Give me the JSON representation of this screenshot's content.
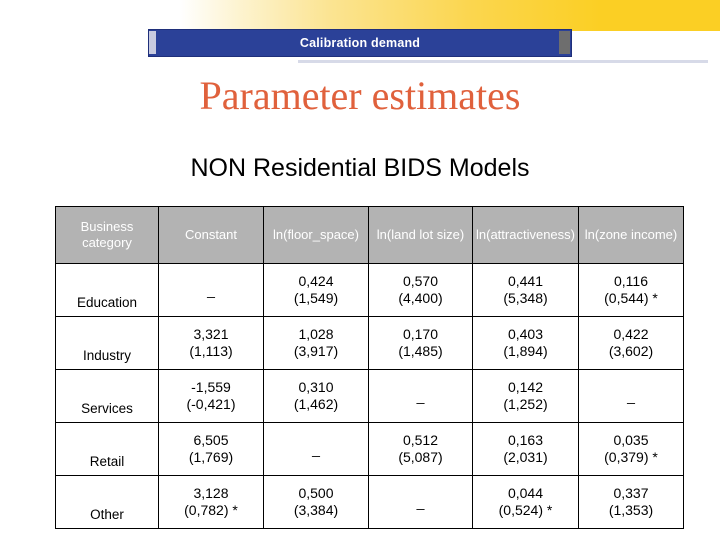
{
  "banner": {
    "label": "Calibration demand"
  },
  "titles": {
    "main": "Parameter estimates",
    "sub": "NON Residential BIDS Models"
  },
  "colors": {
    "title_orange": "#e0613c",
    "banner_blue": "#2b4198",
    "band_yellow": "#fbcf24",
    "header_gray": "#b3b3b3"
  },
  "table": {
    "headers": [
      "Business category",
      "Constant",
      "ln(floor_space)",
      "ln(land lot size)",
      "ln(attractiveness)",
      "ln(zone income)"
    ],
    "rows": [
      {
        "category": "Education",
        "cells": [
          {
            "estimate": "_",
            "tstat": ""
          },
          {
            "estimate": "0,424",
            "tstat": "(1,549)"
          },
          {
            "estimate": "0,570",
            "tstat": "(4,400)"
          },
          {
            "estimate": "0,441",
            "tstat": "(5,348)"
          },
          {
            "estimate": "0,116",
            "tstat": "(0,544) *"
          }
        ]
      },
      {
        "category": "Industry",
        "cells": [
          {
            "estimate": "3,321",
            "tstat": "(1,113)"
          },
          {
            "estimate": "1,028",
            "tstat": "(3,917)"
          },
          {
            "estimate": "0,170",
            "tstat": "(1,485)"
          },
          {
            "estimate": "0,403",
            "tstat": "(1,894)"
          },
          {
            "estimate": "0,422",
            "tstat": "(3,602)"
          }
        ]
      },
      {
        "category": "Services",
        "cells": [
          {
            "estimate": "-1,559",
            "tstat": "(-0,421)"
          },
          {
            "estimate": "0,310",
            "tstat": "(1,462)"
          },
          {
            "estimate": "_",
            "tstat": ""
          },
          {
            "estimate": "0,142",
            "tstat": "(1,252)"
          },
          {
            "estimate": "_",
            "tstat": ""
          }
        ]
      },
      {
        "category": "Retail",
        "cells": [
          {
            "estimate": "6,505",
            "tstat": "(1,769)"
          },
          {
            "estimate": "_",
            "tstat": ""
          },
          {
            "estimate": "0,512",
            "tstat": "(5,087)"
          },
          {
            "estimate": "0,163",
            "tstat": "(2,031)"
          },
          {
            "estimate": "0,035",
            "tstat": "(0,379) *"
          }
        ]
      },
      {
        "category": "Other",
        "cells": [
          {
            "estimate": "3,128",
            "tstat": "(0,782) *"
          },
          {
            "estimate": "0,500",
            "tstat": "(3,384)"
          },
          {
            "estimate": "_",
            "tstat": ""
          },
          {
            "estimate": "0,044",
            "tstat": "(0,524) *"
          },
          {
            "estimate": "0,337",
            "tstat": "(1,353)"
          }
        ]
      }
    ]
  }
}
